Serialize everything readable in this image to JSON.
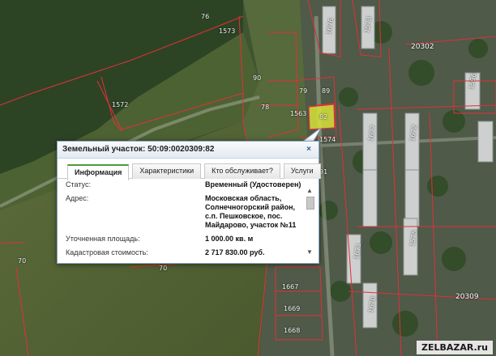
{
  "popup": {
    "title": "Земельный участок: 50:09:0020309:82",
    "close_label": "×",
    "tabs": [
      {
        "label": "Информация",
        "active": true
      },
      {
        "label": "Характеристики",
        "active": false
      },
      {
        "label": "Кто обслуживает?",
        "active": false
      },
      {
        "label": "Услуги",
        "active": false
      }
    ],
    "rows": [
      {
        "key": "Статус:",
        "value": "Временный (Удостоверен)"
      },
      {
        "key": "Адрес:",
        "value": "Московская область, Солнечногорский район, с.п. Пешковское, пос. Майдарово, участок №11"
      },
      {
        "key": "Уточненная площадь:",
        "value": "1 000.00 кв. м"
      },
      {
        "key": "Кадастровая стоимость:",
        "value": "2 717 830.00 руб."
      }
    ],
    "scroll_up": "▲",
    "scroll_down": "▼"
  },
  "map": {
    "parcel_labels": [
      "76",
      "1573",
      "1572",
      "90",
      "79",
      "89",
      "78",
      "1563",
      "82",
      "1574",
      "91",
      "70",
      "70",
      "1667",
      "1669",
      "1668",
      "1676",
      "1671",
      "1677",
      "1672",
      "1670",
      "1575",
      "1596",
      "1573"
    ],
    "quarter_labels": [
      "20302",
      "20309"
    ],
    "selected_parcel": "82"
  },
  "watermark": "ZELBAZAR.ru",
  "colors": {
    "boundary": "#e0303a",
    "selected_fill": "#d7e23a",
    "popup_border": "#8aa6c8",
    "active_tab_accent": "#4d9a3a"
  }
}
